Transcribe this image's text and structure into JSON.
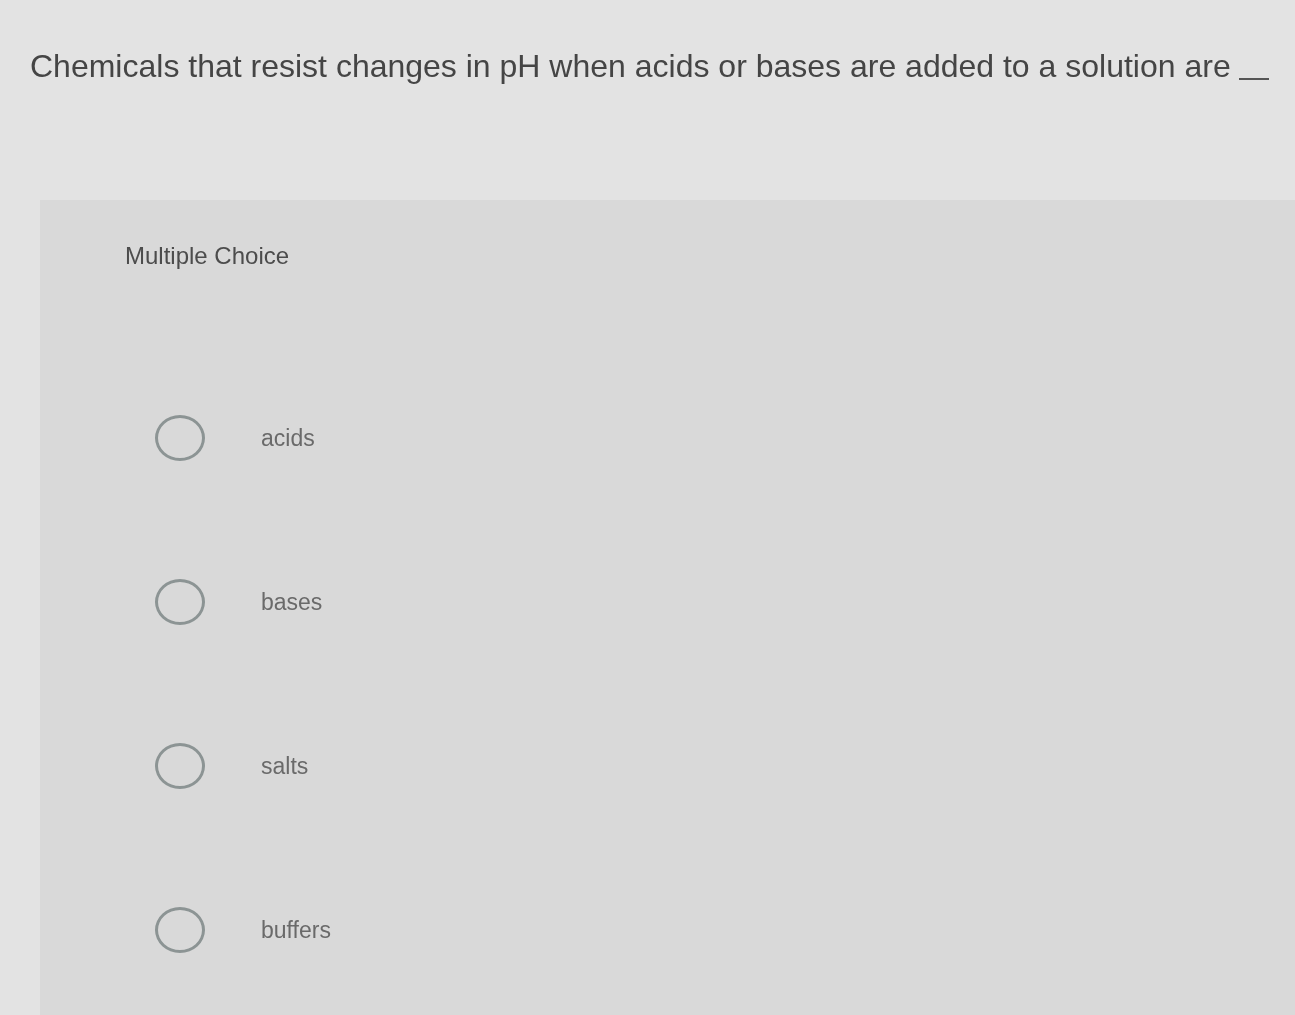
{
  "question": {
    "text": "Chemicals that resist changes in pH when acids or bases are added to a solution are",
    "blank": true
  },
  "panel": {
    "heading": "Multiple Choice",
    "options": [
      {
        "label": "acids",
        "selected": false
      },
      {
        "label": "bases",
        "selected": false
      },
      {
        "label": "salts",
        "selected": false
      },
      {
        "label": "buffers",
        "selected": false
      }
    ]
  }
}
